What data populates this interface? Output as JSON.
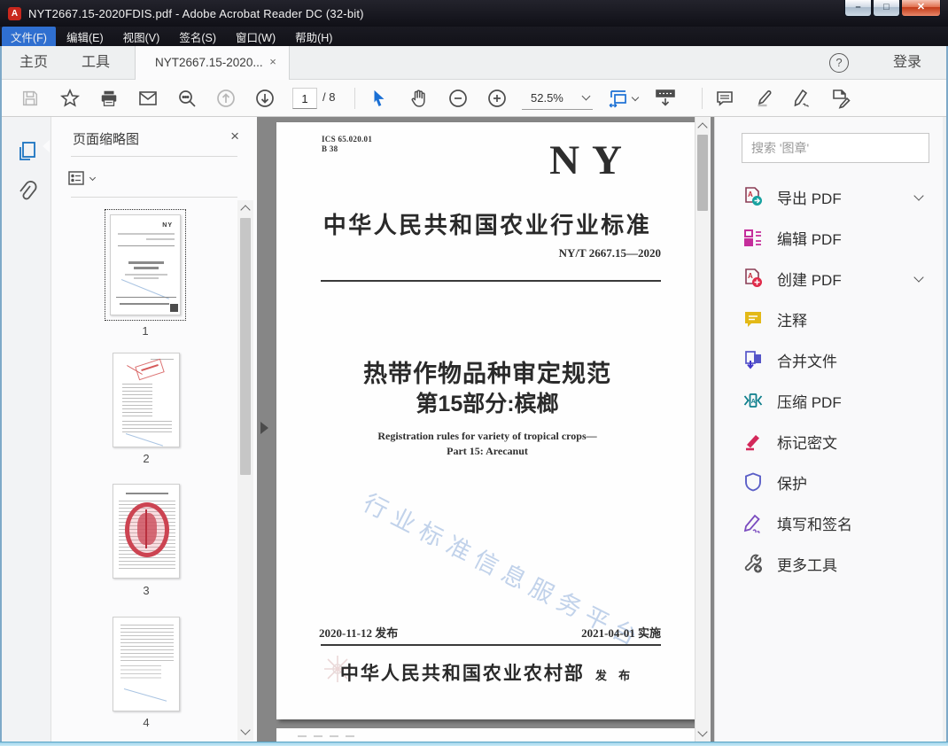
{
  "titlebar": {
    "title": "NYT2667.15-2020FDIS.pdf - Adobe Acrobat Reader DC (32-bit)",
    "app_icon_letter": "A"
  },
  "menubar": {
    "items": [
      {
        "label": "文件(F)"
      },
      {
        "label": "编辑(E)"
      },
      {
        "label": "视图(V)"
      },
      {
        "label": "签名(S)"
      },
      {
        "label": "窗口(W)"
      },
      {
        "label": "帮助(H)"
      }
    ]
  },
  "tabbar": {
    "home": "主页",
    "tools": "工具",
    "document_tab": "NYT2667.15-2020...",
    "close_glyph": "×",
    "help_glyph": "?",
    "login": "登录"
  },
  "toolbar": {
    "page_current": "1",
    "page_total_label": "/ 8",
    "zoom_value": "52.5%"
  },
  "sidebar": {
    "panel_title": "页面缩略图",
    "close_glyph": "×",
    "thumbnails": [
      {
        "number": "1"
      },
      {
        "number": "2"
      },
      {
        "number": "3"
      },
      {
        "number": "4"
      }
    ]
  },
  "document": {
    "ics_line1": "ICS 65.020.01",
    "ics_line2": "B 38",
    "logo": "NY",
    "standard_heading": "中华人民共和国农业行业标准",
    "standard_number": "NY/T 2667.15—2020",
    "title_line1": "热带作物品种审定规范",
    "title_line2": "第15部分:槟榔",
    "title_en_line1": "Registration rules for variety of tropical crops—",
    "title_en_line2": "Part 15: Arecanut",
    "watermark": "行业标准信息服务平台",
    "issue_date": "2020-11-12 发布",
    "impl_date": "2021-04-01 实施",
    "publisher": "中华人民共和国农业农村部",
    "publisher_suffix": "发 布"
  },
  "right_panel": {
    "search_placeholder": "搜索 '图章'",
    "tools": [
      {
        "label": "导出 PDF",
        "icon": "export-pdf-icon",
        "chevron": true,
        "color": "#17a2a0"
      },
      {
        "label": "编辑 PDF",
        "icon": "edit-pdf-icon",
        "chevron": false,
        "color": "#c52e9b"
      },
      {
        "label": "创建 PDF",
        "icon": "create-pdf-icon",
        "chevron": true,
        "color": "#e02a49"
      },
      {
        "label": "注释",
        "icon": "comment-icon",
        "chevron": false,
        "color": "#e3b917"
      },
      {
        "label": "合并文件",
        "icon": "combine-files-icon",
        "chevron": false,
        "color": "#5555c8"
      },
      {
        "label": "压缩 PDF",
        "icon": "compress-pdf-icon",
        "chevron": false,
        "color": "#0e7f8c"
      },
      {
        "label": "标记密文",
        "icon": "redact-icon",
        "chevron": false,
        "color": "#d3285a"
      },
      {
        "label": "保护",
        "icon": "protect-icon",
        "chevron": false,
        "color": "#5b5fc7"
      },
      {
        "label": "填写和签名",
        "icon": "fill-sign-icon",
        "chevron": false,
        "color": "#7a4bbf"
      },
      {
        "label": "更多工具",
        "icon": "more-tools-icon",
        "chevron": false,
        "color": "#555555"
      }
    ]
  }
}
